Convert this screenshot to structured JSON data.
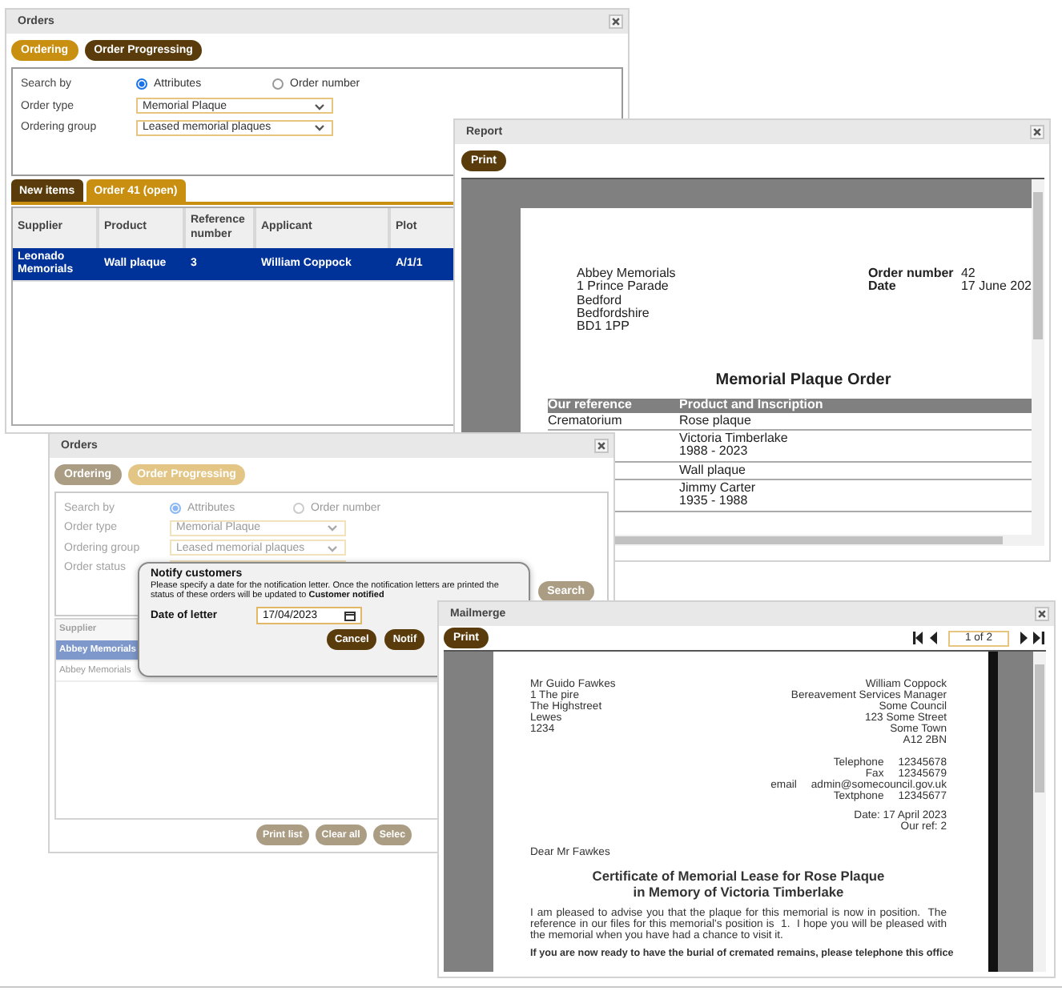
{
  "orders_window": {
    "title": "Orders",
    "disabled": false,
    "modes": [
      {
        "label": "Ordering",
        "selected": true
      },
      {
        "label": "Order Progressing",
        "selected": false
      }
    ],
    "search_by": {
      "label": "Search by",
      "options": [
        {
          "label": "Attributes",
          "selected": true
        },
        {
          "label": "Order number",
          "selected": false
        }
      ]
    },
    "fields": [
      {
        "label": "Order type",
        "value": "Memorial Plaque"
      },
      {
        "label": "Ordering group",
        "value": "Leased memorial plaques"
      }
    ],
    "tabs": [
      {
        "label": "New items",
        "selected": false
      },
      {
        "label": "Order 41 (open)",
        "selected": true
      }
    ],
    "table": {
      "columns": [
        "Supplier",
        "Product",
        "Reference number",
        "Applicant",
        "Plot"
      ],
      "rows": [
        {
          "cells": [
            "Leonado Memorials",
            "Wall plaque",
            "3",
            "William Coppock",
            "A/1/1"
          ],
          "selected": true
        }
      ]
    }
  },
  "report_window": {
    "title": "Report",
    "print_button": "Print",
    "page": {
      "address": [
        "Abbey Memorials",
        "1 Prince Parade",
        "Bedford",
        "Bedfordshire",
        "BD1 1PP"
      ],
      "details": [
        {
          "label": "Order number",
          "value": "42"
        },
        {
          "label": "Date",
          "value": "17 June 202"
        }
      ],
      "heading": "Memorial Plaque Order",
      "columns": [
        "Our reference",
        "Product and Inscription"
      ],
      "rows": [
        {
          "reference": "Crematorium",
          "lines": [
            "Rose plaque"
          ]
        },
        {
          "lines": [
            "Victoria Timberlake",
            "1988 - 2023"
          ]
        },
        {
          "lines": [
            "Wall plaque"
          ]
        },
        {
          "lines": [
            "Jimmy Carter",
            "1935 - 1988"
          ]
        }
      ]
    }
  },
  "progress_window": {
    "title": "Orders",
    "disabled": true,
    "modes": [
      {
        "label": "Ordering",
        "selected": false
      },
      {
        "label": "Order Progressing",
        "selected": true
      }
    ],
    "search_by": {
      "label": "Search by",
      "options": [
        {
          "label": "Attributes",
          "selected": true
        },
        {
          "label": "Order number",
          "selected": false
        }
      ]
    },
    "fields": [
      {
        "label": "Order type",
        "value": "Memorial Plaque"
      },
      {
        "label": "Ordering group",
        "value": "Leased memorial plaques"
      },
      {
        "label": "Order status"
      }
    ],
    "search_button": "Search",
    "table": {
      "columns": [
        "Supplier"
      ],
      "rows": [
        {
          "cells": [
            "Abbey Memorials"
          ],
          "selected": true
        },
        {
          "cells": [
            "Abbey Memorials"
          ],
          "selected": false
        }
      ]
    },
    "footer_buttons": [
      "Print list",
      "Clear all",
      "Selec"
    ]
  },
  "notify_dialog": {
    "title": "Notify customers",
    "message": "Please specify a date for the notification letter. Once the notification letters are printed the status of these orders will be updated to **Customer notified**",
    "date_label": "Date of letter",
    "date_value": "17/04/2023",
    "buttons": [
      "Cancel",
      "Notif"
    ]
  },
  "mailmerge_window": {
    "title": "Mailmerge",
    "print_button": "Print",
    "pager": "1 of 2",
    "letter": {
      "recipient": [
        "Mr Guido Fawkes",
        "1 The pire",
        "The Highstreet",
        "Lewes",
        "1234"
      ],
      "sender": [
        "William Coppock",
        "Bereavement Services Manager",
        "Some Council",
        "123 Some Street",
        "Some Town",
        "A12 2BN"
      ],
      "contacts": [
        {
          "label": "Telephone",
          "value": "12345678"
        },
        {
          "label": "Fax",
          "value": "12345679"
        },
        {
          "label": "email",
          "value": "admin@somecouncil.gov.uk"
        },
        {
          "label": "Textphone",
          "value": "12345677"
        }
      ],
      "date_lines": [
        "Date: 17 April 2023",
        "Our ref: 2"
      ],
      "salutation": "Dear Mr Fawkes",
      "heading": [
        "Certificate of Memorial Lease for Rose Plaque",
        "in Memory of Victoria Timberlake"
      ],
      "paragraph": "I am pleased to advise you that the plaque for this memorial is now in position.  The  reference in our files for this memorial's position is  1.  I hope you will be pleased with the memorial when you have had a chance to visit it.",
      "bold_line": "If you are now ready to have the burial of cremated remains, please telephone this office"
    }
  }
}
